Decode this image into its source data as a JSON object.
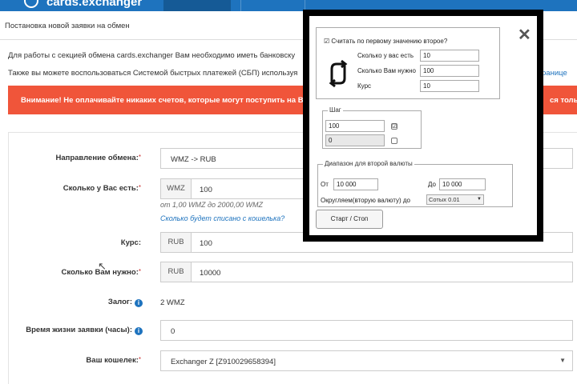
{
  "header": {
    "logo_text": "cards.exchanger"
  },
  "breadcrumb": "Постановка новой заявки на обмен",
  "info": {
    "line1": "Для работы с секцией обмена cards.exchanger Вам необходимо иметь банковску",
    "line2": "Также вы можете воспользоваться Системой быстрых платежей (СБП) используя",
    "line2_tail": "ранице"
  },
  "warning": {
    "text": "Внимание! Не оплачивайте никаких счетов, которые могут поступить на Ваш",
    "tail": "ся тольк"
  },
  "form": {
    "direction": {
      "label": "Направление обмена:",
      "value": "WMZ -> RUB"
    },
    "have": {
      "label": "Сколько у Вас есть:",
      "currency": "WMZ",
      "value": "100",
      "hint": "от 1,00 WMZ до 2000,00 WMZ",
      "link": "Сколько будет списано с кошелька?"
    },
    "rate": {
      "label": "Курс:",
      "currency": "RUB",
      "value": "100"
    },
    "need": {
      "label": "Сколько Вам нужно:",
      "currency": "RUB",
      "value": "10000"
    },
    "deposit": {
      "label": "Залог:",
      "value": "2  WMZ"
    },
    "lifetime": {
      "label": "Время жизни заявки (часы):",
      "value": "0"
    },
    "wallet": {
      "label": "Ваш кошелек:",
      "value": "Exchanger Z [Z910029658394]"
    }
  },
  "dialog": {
    "close_glyph": "✕",
    "calc_checkbox_label": "Считать по первому значению второе?",
    "calc_checkbox_checked": "☑",
    "have_label": "Сколько у вас есть",
    "have_value": "10",
    "need_label": "Сколько Вам нужно",
    "need_value": "100",
    "rate_label": "Курс",
    "rate_value": "10",
    "step_legend": "Шаг",
    "step_value1": "100",
    "step_check1": "☑",
    "step_value2": "0",
    "range_legend": "Диапазон для второй валюты",
    "from_label": "От",
    "from_value": "10 000",
    "to_label": "До",
    "to_value": "10 000",
    "round_label": "Округляем(вторую валюту) до",
    "round_value": "Сотых 0.01",
    "start_stop_label": "Старт / Стоп"
  },
  "icons": {
    "required": "*",
    "info": "i",
    "chevron": "▼",
    "pointer": "↖"
  },
  "colors": {
    "brand": "#1e73be",
    "warning": "#f0553a"
  }
}
